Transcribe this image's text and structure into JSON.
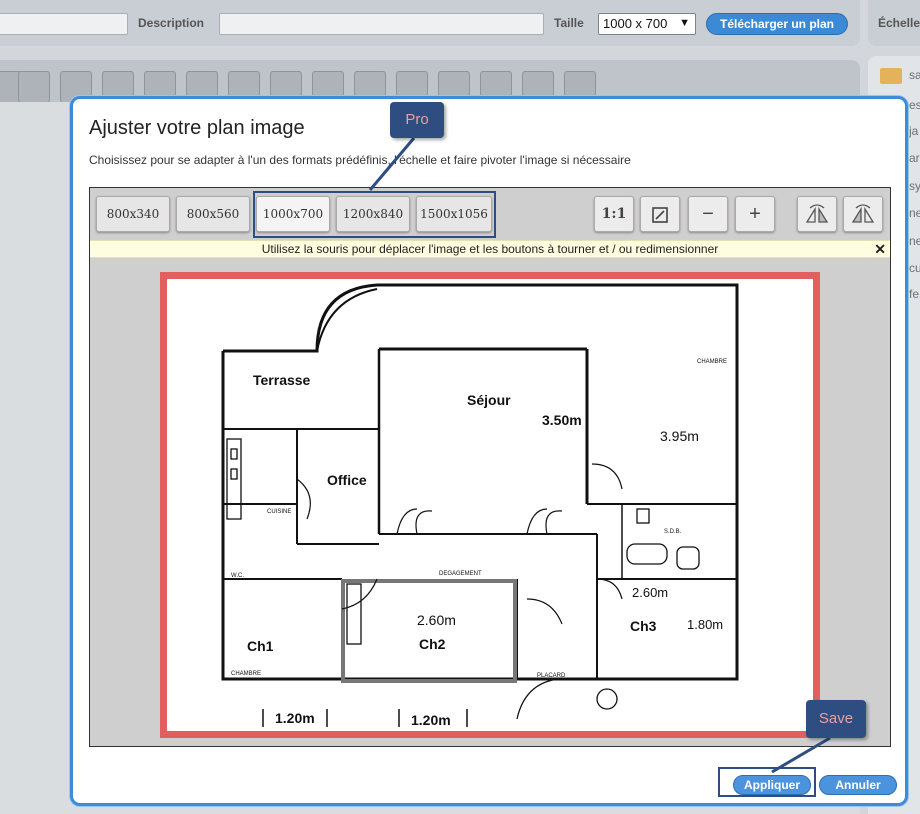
{
  "topbar": {
    "description_label": "Description",
    "size_label": "Taille",
    "size_value": "1000 x 700",
    "upload_button": "Télécharger un plan",
    "scale_label": "Échelle"
  },
  "sidebar": {
    "items": [
      "sa",
      "es",
      "ja",
      "ar",
      "sy",
      "ne",
      "ne",
      "cu",
      "fe"
    ]
  },
  "dialog": {
    "title": "Ajuster votre plan image",
    "subtitle": "Choisissez pour se adapter à l'un des formats prédéfinis, l'échelle et faire pivoter l'image si nécessaire",
    "formats": [
      "800x340",
      "800x560",
      "1000x700",
      "1200x840",
      "1500x1056"
    ],
    "active_format": "1000x700",
    "tools": {
      "one_to_one": "1:1",
      "fit_icon": "fit-icon",
      "zoom_out_icon": "minus-icon",
      "zoom_in_icon": "plus-icon",
      "rotate_left_icon": "rotate-left-icon",
      "rotate_right_icon": "rotate-right-icon"
    },
    "info": "Utilisez la souris pour déplacer l'image et les boutons à tourner et / ou redimensionner",
    "info_close": "✕",
    "apply_button": "Appliquer",
    "cancel_button": "Annuler"
  },
  "plan": {
    "rooms": {
      "terrasse": "Terrasse",
      "sejour": "Séjour",
      "office": "Office",
      "ch1": "Ch1",
      "ch2": "Ch2",
      "ch3": "Ch3"
    },
    "dims": {
      "sejour": "3.50m",
      "chambre": "3.95m",
      "ch2": "2.60m",
      "ch3_a": "2.60m",
      "ch3_b": "1.80m",
      "bottom_left": "1.20m",
      "bottom_mid": "1.20m"
    },
    "small_labels": {
      "chambre_top": "CHAMBRE",
      "chambre_bottom": "CHAMBRE",
      "cuisine": "CUISINE",
      "degagement": "DEGAGEMENT",
      "sdb": "S.D.B.",
      "wc": "W.C.",
      "placard": "PLACARD"
    }
  },
  "callouts": {
    "pro": "Pro",
    "save": "Save"
  },
  "colors": {
    "accent": "#3d8bd9",
    "frame": "#e06060",
    "callout": "#2e4d80",
    "callout_text": "#e8a0a0"
  }
}
